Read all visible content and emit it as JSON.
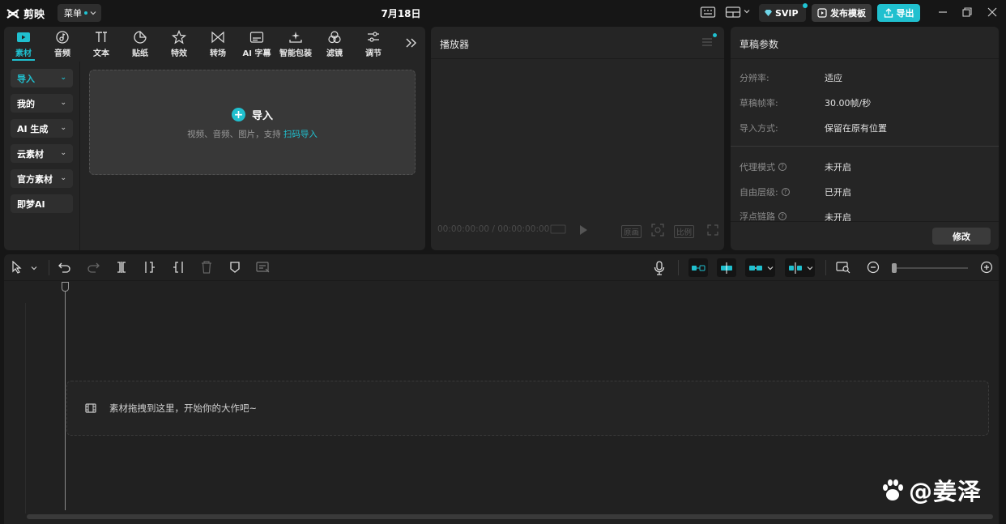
{
  "app": {
    "name": "剪映",
    "menu_label": "菜单",
    "document_title": "7月18日"
  },
  "titlebar": {
    "svip_label": "SVIP",
    "publish_label": "发布模板",
    "export_label": "导出"
  },
  "media_tabs": [
    {
      "label": "素材",
      "icon": "media-icon",
      "active": true
    },
    {
      "label": "音频",
      "icon": "audio-icon"
    },
    {
      "label": "文本",
      "icon": "text-icon"
    },
    {
      "label": "贴纸",
      "icon": "sticker-icon"
    },
    {
      "label": "特效",
      "icon": "effects-icon"
    },
    {
      "label": "转场",
      "icon": "transition-icon"
    },
    {
      "label": "AI 字幕",
      "icon": "ai-caption-icon"
    },
    {
      "label": "智能包装",
      "icon": "smart-package-icon"
    },
    {
      "label": "滤镜",
      "icon": "filter-icon"
    },
    {
      "label": "调节",
      "icon": "adjust-icon"
    }
  ],
  "sidebar": {
    "items": [
      {
        "label": "导入",
        "active": true,
        "has_chevron": true
      },
      {
        "label": "我的",
        "has_chevron": true
      },
      {
        "label": "AI 生成",
        "has_chevron": true
      },
      {
        "label": "云素材",
        "has_chevron": true
      },
      {
        "label": "官方素材",
        "has_chevron": true
      },
      {
        "label": "即梦AI",
        "has_chevron": false
      }
    ]
  },
  "import_box": {
    "title": "导入",
    "desc_prefix": "视频、音频、图片，支持",
    "desc_link": "扫码导入"
  },
  "player": {
    "title": "播放器",
    "current_time": "00:00:00:00",
    "separator": "/",
    "total_time": "00:00:00:00",
    "original_label": "原画",
    "ratio_label": "比例"
  },
  "draft": {
    "title": "草稿参数",
    "rows": [
      {
        "key": "分辨率:",
        "value": "适应",
        "help": false
      },
      {
        "key": "草稿帧率:",
        "value": "30.00帧/秒",
        "help": false
      },
      {
        "key": "导入方式:",
        "value": "保留在原有位置",
        "help": false
      },
      {
        "key": "代理模式",
        "value": "未开启",
        "help": true
      },
      {
        "key": "自由层级:",
        "value": "已开启",
        "help": true
      },
      {
        "key": "浮点链路",
        "value": "未开启",
        "help": true
      }
    ],
    "modify_label": "修改"
  },
  "timeline": {
    "drop_hint": "素材拖拽到这里，开始你的大作吧~"
  },
  "watermark": {
    "text": "@姜泽"
  },
  "colors": {
    "accent": "#20c0cf",
    "background": "#161616",
    "panel": "#252525"
  }
}
